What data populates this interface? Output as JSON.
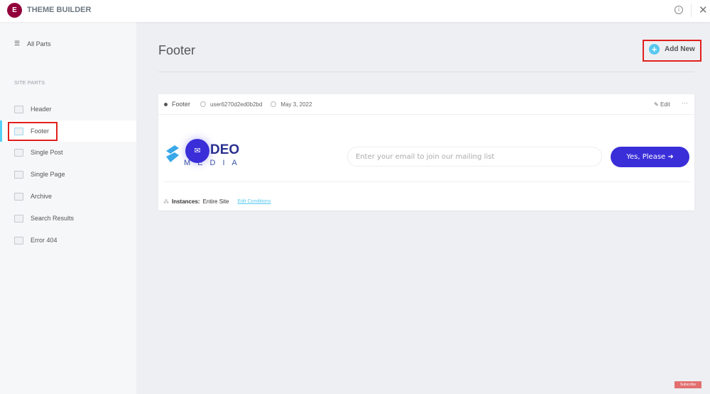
{
  "app": {
    "title": "THEME BUILDER",
    "logo": "elementor-logo"
  },
  "topbar": {
    "icons": [
      "info-icon",
      "close-icon"
    ]
  },
  "sidebar": {
    "all_parts": "All Parts",
    "section_label": "SITE PARTS",
    "items": [
      {
        "label": "Header"
      },
      {
        "label": "Footer",
        "active": true
      },
      {
        "label": "Single Post"
      },
      {
        "label": "Single Page"
      },
      {
        "label": "Archive"
      },
      {
        "label": "Search Results"
      },
      {
        "label": "Error 404"
      }
    ]
  },
  "main": {
    "title": "Footer",
    "add_new": "Add New",
    "card": {
      "title": "Footer",
      "author": "user6270d2ed0b2bd",
      "date": "May 3, 2022",
      "edit": "Edit",
      "more": "···",
      "preview": {
        "brand_deo": "DEO",
        "brand_media": "MEDIA",
        "email_placeholder": "Enter your email to join our mailing list",
        "button": "Yes, Please"
      },
      "instances_label": "Instances:",
      "instances_value": "Entire Site",
      "edit_conditions": "Edit Conditions"
    }
  },
  "overlay": {
    "subscribe": "Subscribe"
  },
  "colors": {
    "accent": "#58c8ef",
    "brand": "#92003b",
    "button": "#3a2ed8",
    "highlight": "#e0201c"
  }
}
